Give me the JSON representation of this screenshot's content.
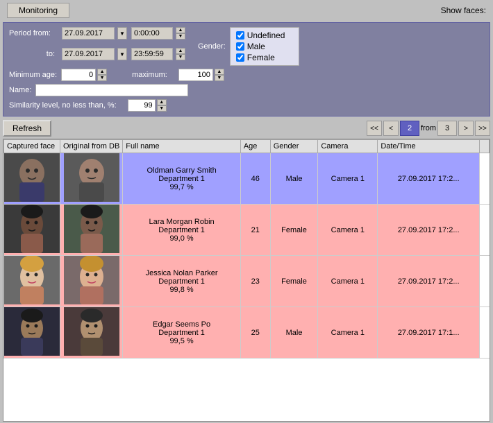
{
  "titleBar": {
    "tab": "Monitoring",
    "showFaces": "Show faces:"
  },
  "filters": {
    "periodLabel": "Period from:",
    "toLabel": "to:",
    "dateFrom": "27.09.2017",
    "timeFrom": "0:00:00",
    "dateTo": "27.09.2017",
    "timeTo": "23:59:59",
    "genderLabel": "Gender:",
    "genderOptions": [
      "Undefined",
      "Male",
      "Female"
    ],
    "minAgeLabel": "Minimum age:",
    "minAge": "0",
    "maxLabel": "maximum:",
    "maxAge": "100",
    "nameLabel": "Name:",
    "nameValue": "",
    "similarityLabel": "Similarity level, no less than, %:",
    "similarityValue": "99"
  },
  "toolbar": {
    "refreshLabel": "Refresh",
    "prevPrevLabel": "<<",
    "prevLabel": "<",
    "currentPage": "2",
    "fromLabel": "from",
    "totalPages": "3",
    "nextLabel": ">",
    "nextNextLabel": ">>"
  },
  "table": {
    "columns": [
      "Captured face",
      "Original from DB",
      "Full name",
      "Age",
      "Gender",
      "Camera",
      "Date/Time"
    ],
    "rows": [
      {
        "rowClass": "row-blue",
        "fullName": "Oldman Garry Smith\nDepartment 1\n99,7 %",
        "fullNameDisplay": "Oldman Garry Smith Department 1 99,7 %",
        "nameLines": [
          "Oldman Garry Smith",
          "Department 1",
          "99,7 %"
        ],
        "age": "46",
        "gender": "Male",
        "camera": "Camera 1",
        "datetime": "27.09.2017 17:2..."
      },
      {
        "rowClass": "row-pink",
        "fullName": "Lara Morgan Robin\nDepartment 1\n99,0 %",
        "nameLines": [
          "Lara Morgan Robin",
          "Department 1",
          "99,0 %"
        ],
        "age": "21",
        "gender": "Female",
        "camera": "Camera 1",
        "datetime": "27.09.2017 17:2..."
      },
      {
        "rowClass": "row-pink",
        "fullName": "Jessica Nolan Parker\nDepartment 1\n99,8 %",
        "nameLines": [
          "Jessica Nolan Parker",
          "Department 1",
          "99,8 %"
        ],
        "age": "23",
        "gender": "Female",
        "camera": "Camera 1",
        "datetime": "27.09.2017 17:2..."
      },
      {
        "rowClass": "row-pink",
        "fullName": "Edgar Seems Po\nDepartment 1\n99,5 %",
        "nameLines": [
          "Edgar Seems Po",
          "Department 1",
          "99,5 %"
        ],
        "age": "25",
        "gender": "Male",
        "camera": "Camera 1",
        "datetime": "27.09.2017 17:1..."
      }
    ]
  },
  "faces": {
    "row0captured": "#555",
    "row0original": "#777",
    "row1captured": "#444",
    "row1original": "#666",
    "row2captured": "#888",
    "row2original": "#999",
    "row3captured": "#333",
    "row3original": "#666"
  }
}
